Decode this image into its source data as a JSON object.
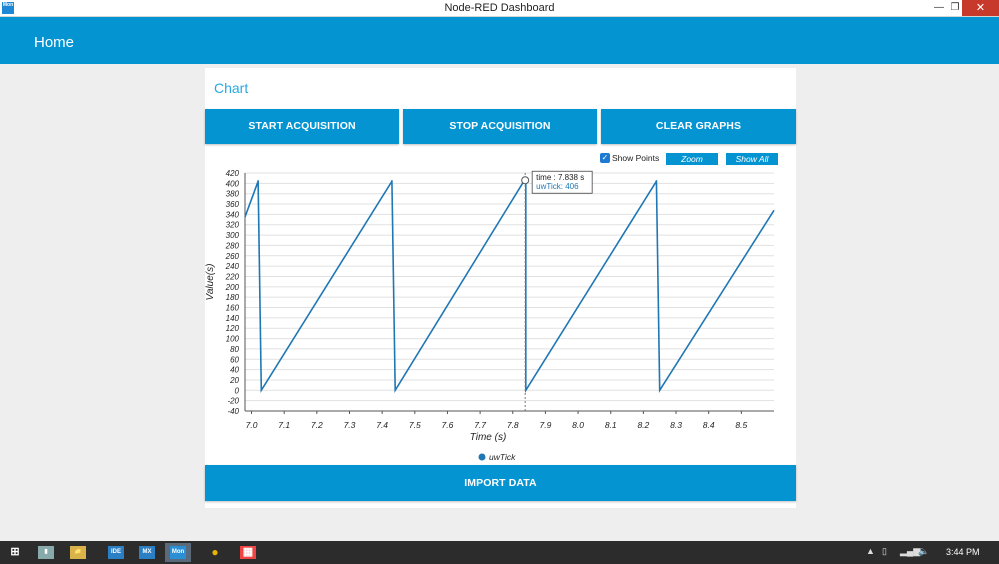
{
  "window": {
    "title": "Node-RED Dashboard",
    "app_icon": "Mon",
    "min": "—",
    "max": "❐",
    "close": "✕"
  },
  "header": {
    "title": "Home"
  },
  "card": {
    "title": "Chart",
    "buttons": {
      "start": "START ACQUISITION",
      "stop": "STOP ACQUISITION",
      "clear": "CLEAR GRAPHS",
      "import": "IMPORT DATA"
    },
    "tools": {
      "show_points_label": "Show Points",
      "show_points_checked": true,
      "zoom": "Zoom",
      "show_all": "Show All"
    }
  },
  "chart_data": {
    "type": "line",
    "xlabel": "Time (s)",
    "ylabel": "Value(s)",
    "xlim": [
      6.98,
      8.6
    ],
    "ylim": [
      -40,
      420
    ],
    "xticks": [
      "7.0",
      "7.1",
      "7.2",
      "7.3",
      "7.4",
      "7.5",
      "7.6",
      "7.7",
      "7.8",
      "7.9",
      "8.0",
      "8.1",
      "8.2",
      "8.3",
      "8.4",
      "8.5"
    ],
    "yticks": [
      -40,
      -20,
      0,
      20,
      40,
      60,
      80,
      100,
      120,
      140,
      160,
      180,
      200,
      220,
      240,
      260,
      280,
      300,
      320,
      340,
      360,
      380,
      400,
      420
    ],
    "legend_placement": "bottom",
    "grid": true,
    "series": [
      {
        "name": "uwTick",
        "color": "#1f77b4",
        "x": [
          6.98,
          7.02,
          7.02,
          7.03,
          7.43,
          7.43,
          7.44,
          7.83,
          7.84,
          7.84,
          8.24,
          8.24,
          8.25,
          8.6
        ],
        "y": [
          335,
          404,
          406,
          0,
          404,
          406,
          0,
          400,
          406,
          0,
          404,
          406,
          0,
          348
        ]
      }
    ],
    "tooltip": {
      "time_label": "time : 7.838 s",
      "value_label": "uwTick: 406",
      "x": 7.838,
      "y": 406
    }
  },
  "taskbar": {
    "items": [
      {
        "name": "start",
        "label": "⊞"
      },
      {
        "name": "calculator",
        "label": "▮"
      },
      {
        "name": "explorer",
        "label": "📁"
      },
      {
        "name": "ide",
        "label": "IDE"
      },
      {
        "name": "mx",
        "label": "MX"
      },
      {
        "name": "mon",
        "label": "Mon"
      },
      {
        "name": "chrome",
        "label": "●"
      },
      {
        "name": "paint",
        "label": "▦"
      }
    ],
    "tray_up": "▲",
    "clock": "3:44 PM"
  }
}
